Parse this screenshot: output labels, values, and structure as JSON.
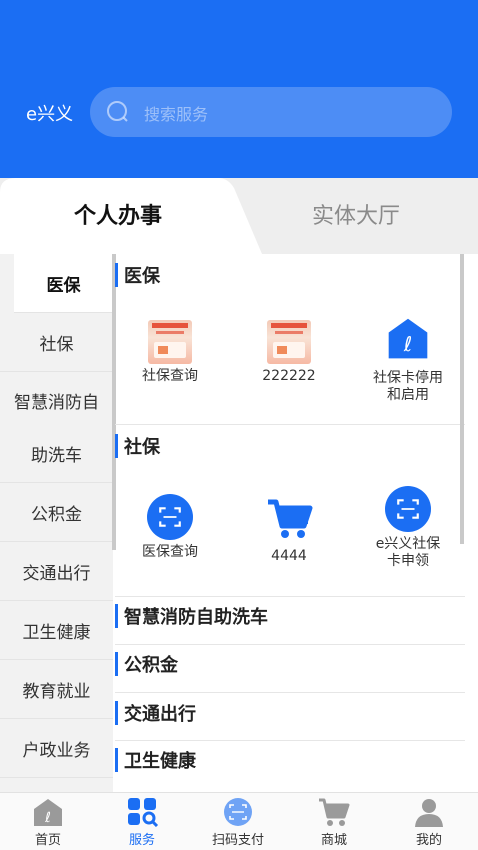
{
  "header": {
    "brand": "e兴义",
    "search_placeholder": "搜索服务"
  },
  "tabs": {
    "personal": "个人办事",
    "hall": "实体大厅",
    "active": "personal"
  },
  "leftnav": {
    "items": [
      {
        "label": "医保",
        "active": true
      },
      {
        "label": "社保"
      },
      {
        "label": "智慧消防自"
      },
      {
        "label": "助洗车"
      },
      {
        "label": "公积金"
      },
      {
        "label": "交通出行"
      },
      {
        "label": "卫生健康"
      },
      {
        "label": "教育就业"
      },
      {
        "label": "户政业务"
      }
    ]
  },
  "content": {
    "sections": [
      {
        "title": "医保",
        "items": [
          {
            "label": "社保查询",
            "icon": "promo-thumbnail-icon"
          },
          {
            "label": "222222",
            "icon": "promo-thumbnail-icon"
          },
          {
            "label": "社保卡停用和启用",
            "label_lines": [
              "社保卡停用",
              "和启用"
            ],
            "icon": "card-house-icon"
          }
        ]
      },
      {
        "title": "社保",
        "items": [
          {
            "label": "医保查询",
            "icon": "scan-icon"
          },
          {
            "label": "4444",
            "icon": "cart-icon"
          },
          {
            "label": "e兴义社保卡申领",
            "label_lines": [
              "e兴义社保",
              "卡申领"
            ],
            "icon": "scan-icon"
          }
        ]
      },
      {
        "title": "智慧消防自助洗车"
      },
      {
        "title": "公积金"
      },
      {
        "title": "交通出行"
      },
      {
        "title": "卫生健康"
      }
    ]
  },
  "bottombar": {
    "items": [
      {
        "label": "首页",
        "icon": "home-icon"
      },
      {
        "label": "服务",
        "icon": "services-icon",
        "active": true
      },
      {
        "label": "扫码支付",
        "icon": "scan-pay-icon"
      },
      {
        "label": "商城",
        "icon": "mall-cart-icon"
      },
      {
        "label": "我的",
        "icon": "profile-icon"
      }
    ]
  },
  "colors": {
    "primary": "#1b6ef3",
    "header_bg": "#1b6ef3",
    "nav_bg": "#f2f2f2",
    "inactive_tab": "#8a8a8a"
  }
}
